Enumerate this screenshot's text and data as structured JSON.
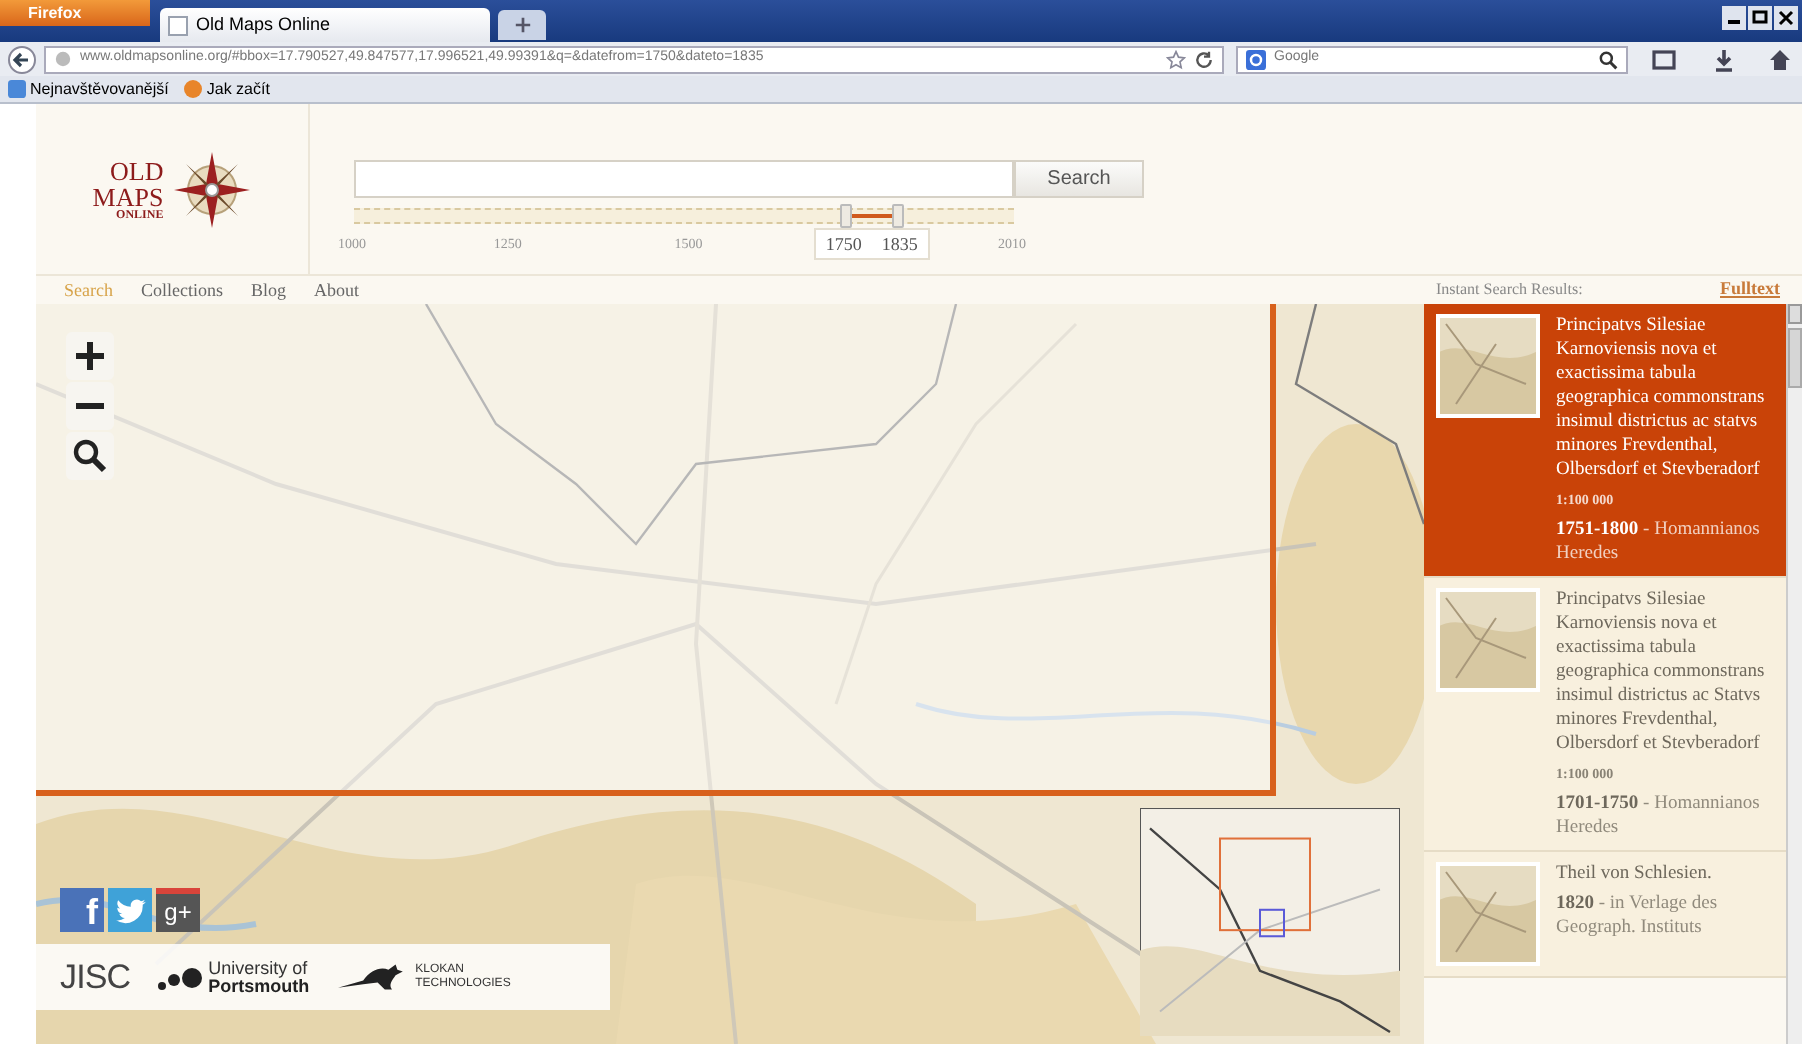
{
  "browser": {
    "menu_button": "Firefox",
    "tab": {
      "title": "Old Maps Online"
    },
    "url": "www.oldmapsonline.org/#bbox=17.790527,49.847577,17.996521,49.99391&q=&datefrom=1750&dateto=1835",
    "web_search": {
      "engine": "Google"
    },
    "bookmarks": [
      "Nejnavštěvovanější",
      "Jak začít"
    ]
  },
  "logo": {
    "line_1": "OLD",
    "line_2": "MAPS",
    "line_3": "ONLINE"
  },
  "search": {
    "button": "Search"
  },
  "timeline": {
    "ticks": [
      "1000",
      "1250",
      "1500",
      "2010"
    ],
    "range": [
      {
        "label": "1750",
        "level": 0.745
      },
      {
        "label": "1835",
        "level": 0.824
      }
    ]
  },
  "nav": [
    {
      "label": "Search",
      "selected": true
    },
    {
      "label": "Collections",
      "selected": false
    },
    {
      "label": "Blog",
      "selected": false
    },
    {
      "label": "About",
      "selected": false
    }
  ],
  "results_header": {
    "title": "Instant Search Results:",
    "link": "Fulltext"
  },
  "results": [
    {
      "title": "Principatvs Silesiae Karnoviensis nova et exactissima tabula geographica commonstrans insimul districtus ac statvs minores Frevdenthal, Olbersdorf et Stevberadorf",
      "scale": "1:100 000",
      "years": "1751-1800",
      "publisher": "- Homannianos Heredes",
      "selected": true
    },
    {
      "title": "Principatvs Silesiae Karnoviensis nova et exactissima tabula geographica commonstrans insimul districtus ac Statvs minores Frevdenthal, Olbersdorf et Stevberadorf",
      "scale": "1:100 000",
      "years": "1701-1750",
      "publisher": "- Homannianos Heredes",
      "selected": false
    },
    {
      "title": "Theil von Schlesien.",
      "years": "1820",
      "publisher": "- in Verlage des Geograph. Instituts",
      "selected": false
    }
  ],
  "social": [
    {
      "kind": "facebook",
      "label": "f"
    },
    {
      "kind": "twitter"
    },
    {
      "kind": "google",
      "label": "g+"
    }
  ],
  "partners": {
    "jisc": "JISC",
    "university_line_1": "University of",
    "university_line_2": "Portsmouth",
    "klokan_line_1": "KLOKAN",
    "klokan_line_2": "TECHNOLOGIES"
  }
}
